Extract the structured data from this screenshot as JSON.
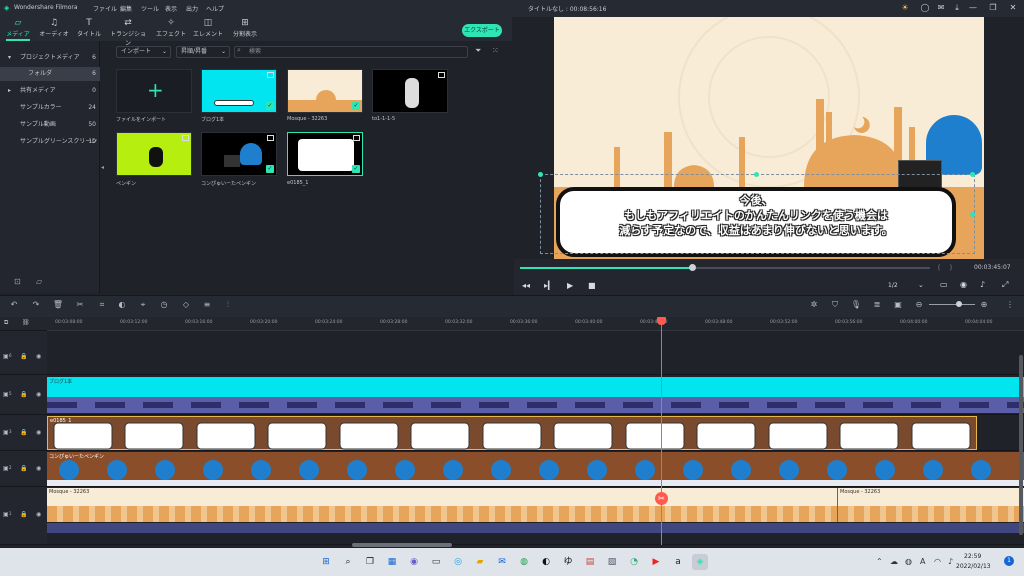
{
  "titlebar": {
    "app_name": "Wondershare Filmora",
    "project_title": "タイトルなし : 00:08:56:16",
    "menu": [
      "ファイル",
      "編集",
      "ツール",
      "表示",
      "出力",
      "ヘルプ"
    ]
  },
  "toolbar": {
    "tabs": [
      {
        "label": "メディア",
        "icon": "folder-icon"
      },
      {
        "label": "オーディオ",
        "icon": "music-icon"
      },
      {
        "label": "タイトル",
        "icon": "title-icon"
      },
      {
        "label": "トランジション",
        "icon": "transition-icon"
      },
      {
        "label": "エフェクト",
        "icon": "effect-icon"
      },
      {
        "label": "エレメント",
        "icon": "element-icon"
      },
      {
        "label": "分割表示",
        "icon": "split-icon"
      }
    ],
    "export_label": "エクスポート"
  },
  "sidebar": {
    "items": [
      {
        "label": "プロジェクトメディア",
        "count": "6"
      },
      {
        "label": "フォルダ",
        "count": "6"
      },
      {
        "label": "共有メディア",
        "count": "0"
      },
      {
        "label": "サンプルカラー",
        "count": "24"
      },
      {
        "label": "サンプル動画",
        "count": "50"
      },
      {
        "label": "サンプルグリーンスクリーン",
        "count": "10"
      }
    ]
  },
  "media": {
    "import_label": "インポート",
    "sort_label": "昇順/昇番",
    "search_placeholder": "検索",
    "items": [
      "ファイルをインポート",
      "ブログ1本",
      "Mosque - 32263",
      "to1-1-1-5",
      "ペンギン",
      "コンぴゅいーたペンギン",
      "e0185_1"
    ]
  },
  "preview": {
    "caption_line1": "今後、",
    "caption_line2": "もしもアフィリエイトのかんたんリンクを使う機会は",
    "caption_line3": "減らす予定なので、収益はあまり伸びないと思います。",
    "timecode": "00:03:45:07",
    "zoom": "1/2",
    "progress": 0.42
  },
  "timeline": {
    "ruler": [
      "00:03:08:00",
      "00:03:12:00",
      "00:03:16:00",
      "00:03:20:00",
      "00:03:24:00",
      "00:03:28:00",
      "00:03:32:00",
      "00:03:36:00",
      "00:03:40:00",
      "00:03:44:00",
      "00:03:48:00",
      "00:03:52:00",
      "00:03:56:00",
      "00:04:00:00",
      "00:04:04:00"
    ],
    "tracks": [
      {
        "clip": "",
        "num": "6"
      },
      {
        "clip": "ブログ1本",
        "num": "5"
      },
      {
        "clip": "e0185_1",
        "num": "3"
      },
      {
        "clip": "コンぴゅいーたペンギン",
        "num": "2"
      },
      {
        "clip": "Mosque - 32263",
        "num": "1"
      }
    ],
    "mosque_second": "Mosque - 32263"
  },
  "taskbar": {
    "time": "22:59",
    "date": "2022/02/13",
    "notif": "1"
  }
}
